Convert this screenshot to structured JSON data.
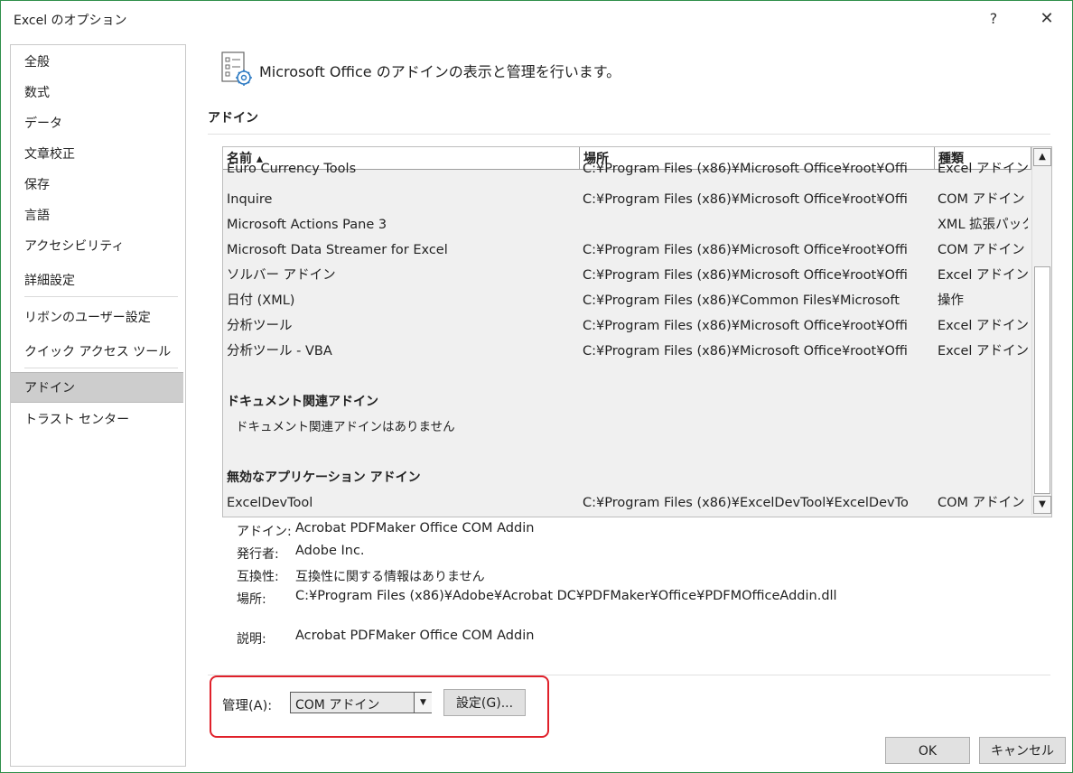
{
  "window": {
    "title": "Excel のオプション",
    "help": "?",
    "close": "✕"
  },
  "sidebar": {
    "items": [
      {
        "label": "全般"
      },
      {
        "label": "数式"
      },
      {
        "label": "データ"
      },
      {
        "label": "文章校正"
      },
      {
        "label": "保存"
      },
      {
        "label": "言語"
      },
      {
        "label": "アクセシビリティ"
      },
      {
        "label": "詳細設定"
      },
      {
        "label": "リボンのユーザー設定"
      },
      {
        "label": "クイック アクセス ツール バー"
      },
      {
        "label": "アドイン",
        "selected": true
      },
      {
        "label": "トラスト センター"
      }
    ]
  },
  "header": {
    "text": "Microsoft Office のアドインの表示と管理を行います。",
    "icon": "addin-settings-icon"
  },
  "section": {
    "title": "アドイン"
  },
  "table": {
    "columns": {
      "name": "名前 ▴",
      "location": "場所",
      "type": "種類"
    },
    "rows": [
      {
        "name": "Euro Currency Tools",
        "location": "C:¥Program Files (x86)¥Microsoft Office¥root¥Offi",
        "type": "Excel アドイン"
      },
      {
        "name": "Inquire",
        "location": "C:¥Program Files (x86)¥Microsoft Office¥root¥Offi",
        "type": "COM アドイン"
      },
      {
        "name": "Microsoft Actions Pane 3",
        "location": "",
        "type": "XML 拡張パック"
      },
      {
        "name": "Microsoft Data Streamer for Excel",
        "location": "C:¥Program Files (x86)¥Microsoft Office¥root¥Offi",
        "type": "COM アドイン"
      },
      {
        "name": "ソルバー アドイン",
        "location": "C:¥Program Files (x86)¥Microsoft Office¥root¥Offi",
        "type": "Excel アドイン"
      },
      {
        "name": "日付 (XML)",
        "location": "C:¥Program Files (x86)¥Common Files¥Microsoft",
        "type": "操作"
      },
      {
        "name": "分析ツール",
        "location": "C:¥Program Files (x86)¥Microsoft Office¥root¥Offi",
        "type": "Excel アドイン"
      },
      {
        "name": "分析ツール - VBA",
        "location": "C:¥Program Files (x86)¥Microsoft Office¥root¥Offi",
        "type": "Excel アドイン"
      }
    ],
    "group_doc": {
      "title": "ドキュメント関連アドイン",
      "empty": "ドキュメント関連アドインはありません"
    },
    "group_disabled": {
      "title": "無効なアプリケーション アドイン"
    },
    "disabled_rows": [
      {
        "name": "ExcelDevTool",
        "location": "C:¥Program Files (x86)¥ExcelDevTool¥ExcelDevTo",
        "type": "COM アドイン"
      }
    ]
  },
  "details": {
    "addin": {
      "label": "アドイン:",
      "value": "Acrobat PDFMaker Office COM Addin"
    },
    "publisher": {
      "label": "発行者:",
      "value": "Adobe Inc."
    },
    "compat": {
      "label": "互換性:",
      "value": "互換性に関する情報はありません"
    },
    "location": {
      "label": "場所:",
      "value": "C:¥Program Files (x86)¥Adobe¥Acrobat DC¥PDFMaker¥Office¥PDFMOfficeAddin.dll"
    },
    "description": {
      "label": "説明:",
      "value": "Acrobat PDFMaker Office COM Addin"
    }
  },
  "manage": {
    "label": "管理(A):",
    "selected": "COM アドイン",
    "go_button": "設定(G)..."
  },
  "footer": {
    "ok": "OK",
    "cancel": "キャンセル"
  },
  "colors": {
    "highlight": "#e0202a",
    "selected_nav": "#cdcdcd",
    "window_border": "#2f8f4a"
  }
}
